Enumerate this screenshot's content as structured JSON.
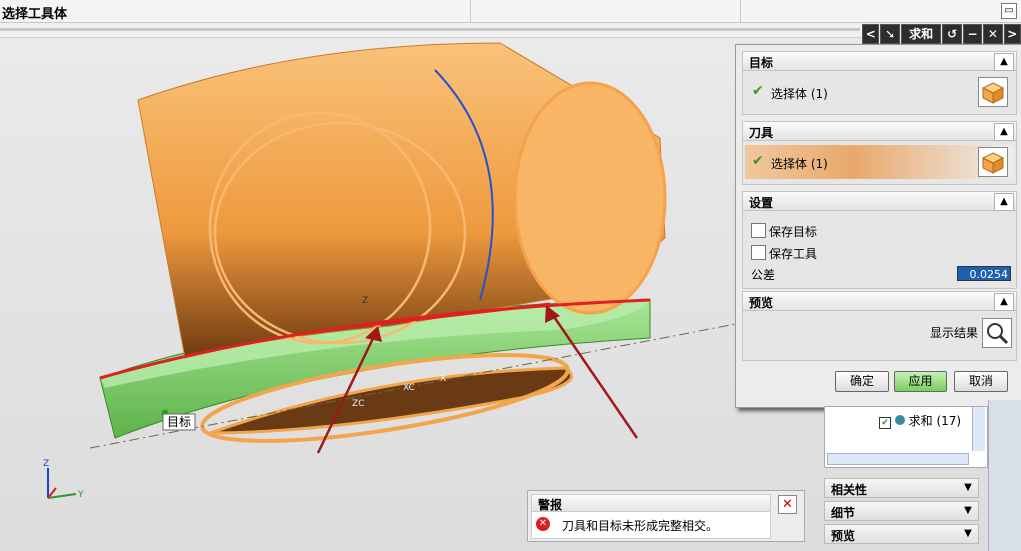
{
  "window": {
    "title": "选择工具体"
  },
  "toolbar": {
    "back": "<",
    "pick": "➘",
    "command": "求和",
    "reset": "↺",
    "minimize": "−",
    "close": "✕",
    "forward": ">"
  },
  "dialog": {
    "target": {
      "header": "目标",
      "select": "选择体 (1)"
    },
    "tool": {
      "header": "刀具",
      "select": "选择体 (1)"
    },
    "settings": {
      "header": "设置",
      "keep_target": "保存目标",
      "keep_tool": "保存工具",
      "tolerance_label": "公差",
      "tolerance_value": "0.0254"
    },
    "preview": {
      "header": "预览",
      "show_result": "显示结果"
    },
    "buttons": {
      "ok": "确定",
      "apply": "应用",
      "cancel": "取消"
    }
  },
  "navigator": {
    "item": "求和 (17)"
  },
  "panels": {
    "dependencies": "相关性",
    "details": "细节",
    "preview": "预览"
  },
  "viewport": {
    "target_label": "目标",
    "axis_z": "Z",
    "axis_y": "Y",
    "axis_x": "X",
    "axis_zc": "ZC",
    "axis_xc": "XC"
  },
  "warning": {
    "title": "警报",
    "message": "刀具和目标未形成完整相交。"
  },
  "colors": {
    "body_orange": "#f2a54a",
    "body_green": "#7ed06a",
    "highlight": "#e02020",
    "apply_green": "#7ccc5e",
    "selection_blue": "#1e5fb4"
  }
}
